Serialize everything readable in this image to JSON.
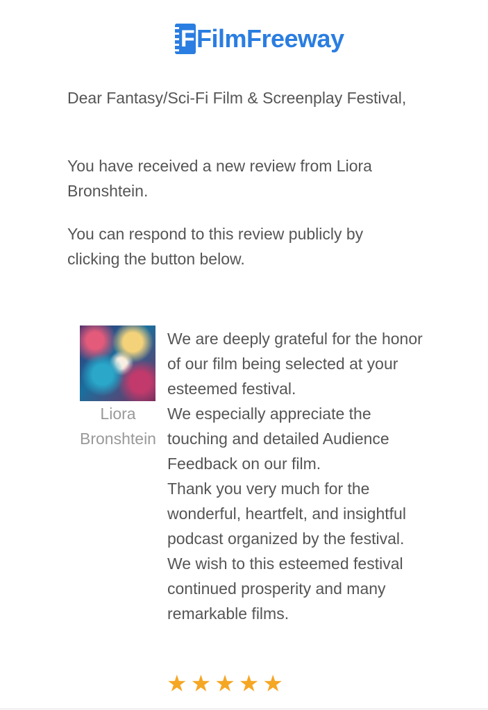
{
  "header": {
    "logo_text": "FilmFreeway",
    "logo_mark_letter": "F",
    "brand_color": "#2a7de1"
  },
  "email": {
    "greeting": "Dear Fantasy/Sci-Fi Film & Screenplay Festival,",
    "intro": "You have received a new review from Liora Bronshtein.",
    "instruction": "You can respond to this review publicly by clicking the button below."
  },
  "review": {
    "reviewer_name": "Liora Bronshtein",
    "avatar": "reviewer-avatar-image",
    "text_lines": [
      "We are deeply grateful for the honor of our film being selected at your esteemed festival.",
      "We especially appreciate the touching and detailed Audience Feedback on our film.",
      "Thank you very much for the wonderful, heartfelt, and insightful podcast organized by the festival.",
      "We wish to this esteemed festival continued prosperity and many remarkable films."
    ],
    "rating": 5,
    "rating_max": 5,
    "star_color": "#f5a623",
    "star_glyph": "★"
  }
}
